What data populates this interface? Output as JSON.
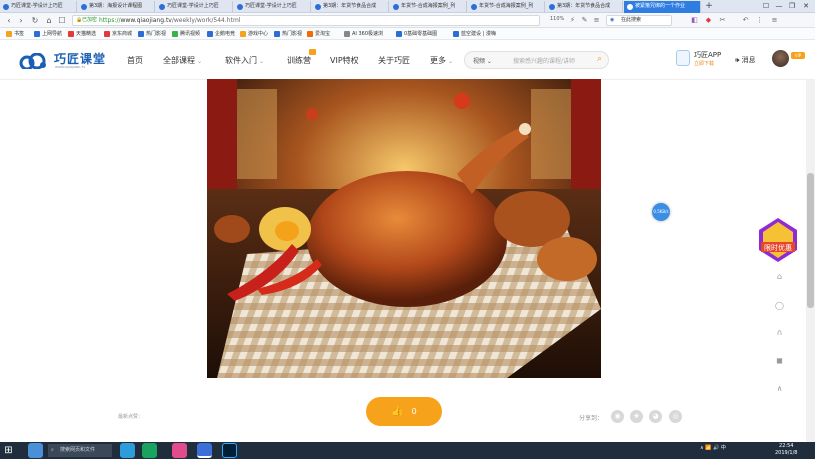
{
  "browser": {
    "tabs": [
      {
        "label": "巧匠课堂-学设计上巧匠"
      },
      {
        "label": "第3期：海报设计课程图"
      },
      {
        "label": "巧匠课堂-学设计上巧匠"
      },
      {
        "label": "巧匠课堂-学设计上巧匠"
      },
      {
        "label": "第3期：年货节食品合成"
      },
      {
        "label": "年货节-合成海报案例_列"
      },
      {
        "label": "年货节-合成海报案例_列"
      },
      {
        "label": "第3期：年货节食品合成"
      },
      {
        "label": "被紧箍咒绑的一个作业"
      }
    ],
    "new_tab": "+",
    "window_controls": [
      "☐",
      "—",
      "❐",
      "✕"
    ],
    "url": {
      "secure_label": "已加密",
      "scheme": "https://",
      "host": "www.qiaojiang.tv",
      "path": "/weekly/work/544.html"
    },
    "zoom": "110%",
    "search_placeholder": "在此搜索",
    "bookmarks": [
      {
        "label": "书签",
        "color": "#f7a21b"
      },
      {
        "label": "上网导航",
        "color": "#2d6ed6"
      },
      {
        "label": "天猫精选",
        "color": "#e4393c"
      },
      {
        "label": "京东商城",
        "color": "#e4393c"
      },
      {
        "label": "热门影视",
        "color": "#2d6ed6"
      },
      {
        "label": "腾讯视频",
        "color": "#37b34a"
      },
      {
        "label": "企鹅电竞",
        "color": "#2d6ed6"
      },
      {
        "label": "游戏中心",
        "color": "#f7a21b"
      },
      {
        "label": "热门影视",
        "color": "#2d6ed6"
      },
      {
        "label": "爱淘宝",
        "color": "#f56a00"
      },
      {
        "label": "AI 360极速浏",
        "color": "#888888"
      },
      {
        "label": "0基础零基础图",
        "color": "#2d6ed6"
      },
      {
        "label": "蓝空建设 | 漫嗨",
        "color": "#2d6ed6"
      }
    ]
  },
  "site": {
    "logo_name": "巧匠课堂",
    "logo_sub": "WWW.QIAOJIANG.TV",
    "nav": [
      {
        "label": "首页",
        "chevron": false
      },
      {
        "label": "全部课程",
        "chevron": true
      },
      {
        "label": "软件入门",
        "chevron": true
      },
      {
        "label": "训练营",
        "chevron": false
      },
      {
        "label": "VIP特权",
        "chevron": false
      },
      {
        "label": "关于巧匠",
        "chevron": false
      },
      {
        "label": "更多",
        "chevron": true
      }
    ],
    "search": {
      "category": "视频 ⌄",
      "placeholder": "搜索感兴趣的课程/讲师"
    },
    "app": {
      "title": "巧匠APP",
      "sub": "立即下载"
    },
    "messages": "消息",
    "vip_badge": "VIP"
  },
  "work": {
    "caption": "最新点赞：",
    "likes": "0",
    "share_label": "分享到：",
    "share_icons": [
      "wechat-icon",
      "qzone-icon",
      "qq-icon",
      "weibo-icon"
    ]
  },
  "float_badge": "0.5KB/s",
  "promo": "限时优惠",
  "side_tools": [
    "cart-icon",
    "chat-icon",
    "headset-icon",
    "feedback-icon",
    "back-to-top-icon"
  ],
  "taskbar": {
    "search_placeholder": "搜索网页和文件",
    "tray_text": "∧ 📶 🔊 中",
    "time": "22:54",
    "date": "2019/1/8"
  }
}
